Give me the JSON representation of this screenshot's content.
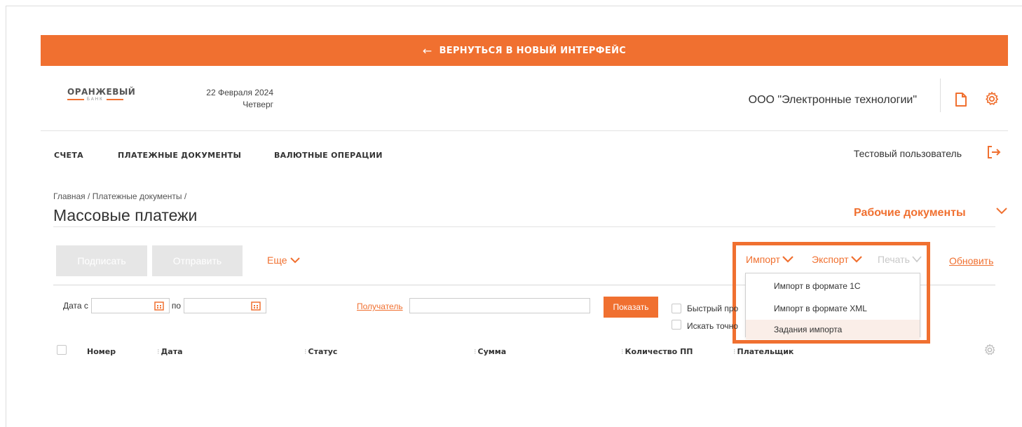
{
  "banner": {
    "arrow": "←",
    "label": "ВЕРНУТЬСЯ В НОВЫЙ ИНТЕРФЕЙС"
  },
  "header": {
    "logo_name": "ОРАНЖЕВЫЙ",
    "logo_sub": "БАНК",
    "date": "22 Февраля 2024",
    "weekday": "Четверг",
    "organization": "ООО \"Электронные технологии\""
  },
  "nav": {
    "items": [
      "СЧЕТА",
      "ПЛАТЕЖНЫЕ ДОКУМЕНТЫ",
      "ВАЛЮТНЫЕ ОПЕРАЦИИ"
    ],
    "user": "Тестовый пользователь"
  },
  "breadcrumb": {
    "home": "Главная",
    "section": "Платежные документы",
    "sep": "/"
  },
  "page": {
    "title": "Массовые платежи",
    "workdocs": "Рабочие документы"
  },
  "toolbar": {
    "sign": "Подписать",
    "send": "Отправить",
    "more": "Еще",
    "import": "Импорт",
    "export": "Экспорт",
    "print": "Печать",
    "refresh": "Обновить"
  },
  "import_menu": {
    "items": [
      "Импорт в формате 1С",
      "Импорт в формате XML",
      "Задания импорта"
    ]
  },
  "filters": {
    "date_from_label": "Дата с",
    "date_to_label": "по",
    "date_from_value": "",
    "date_to_value": "",
    "recipient_label": "Получатель",
    "recipient_value": "",
    "show": "Показать",
    "quick_view": "Быстрый про",
    "exact_search": "Искать точно"
  },
  "table": {
    "columns": [
      "Номер",
      "Дата",
      "Статус",
      "Сумма",
      "Количество ПП",
      "Плательщик"
    ]
  },
  "colors": {
    "accent": "#f07030",
    "disabled_btn": "#e6e6e6"
  }
}
